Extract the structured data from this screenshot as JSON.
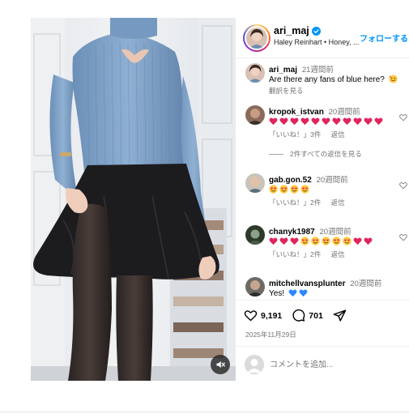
{
  "post": {
    "username": "ari_maj",
    "subtitle": "Haley Reinhart • Honey, ...",
    "follow_label": "フォローする",
    "caption_time": "21週間前",
    "caption_text": "Are there any fans of blue here?",
    "caption_emoji": "smiling-face-with-hearts",
    "translate_label": "翻訳を見る"
  },
  "comments": [
    {
      "user": "kropok_istvan",
      "time": "20週間前",
      "emojis": [
        "red-heart",
        "red-heart",
        "red-heart",
        "red-heart",
        "red-heart",
        "red-heart",
        "red-heart",
        "red-heart",
        "red-heart",
        "red-heart",
        "red-heart"
      ],
      "likes": "「いいね！」3件",
      "reply": "返信",
      "view_replies": "2件すべての返信を見る"
    },
    {
      "user": "gab.gon.52",
      "time": "20週間前",
      "emojis": [
        "heart-eyes",
        "heart-eyes",
        "heart-eyes",
        "heart-eyes"
      ],
      "likes": "「いいね！」2件",
      "reply": "返信"
    },
    {
      "user": "chanyk1987",
      "time": "20週間前",
      "emojis": [
        "red-heart",
        "red-heart",
        "red-heart",
        "heart-eyes",
        "heart-eyes",
        "heart-eyes",
        "heart-eyes",
        "heart-eyes",
        "red-heart",
        "red-heart"
      ],
      "likes": "「いいね！」2件",
      "reply": "返信"
    },
    {
      "user": "mitchellvansplunter",
      "time": "20週間前",
      "text": "Yes!",
      "emojis": [
        "blue-heart",
        "blue-heart"
      ]
    }
  ],
  "actions": {
    "like_count": "9,191",
    "comment_count": "701",
    "date": "2025年11月29日"
  },
  "composer": {
    "placeholder": "コメントを追加..."
  },
  "colors": {
    "accent": "#0095f6",
    "muted": "#737373",
    "heart_red": "#e0245e",
    "blue_heart": "#2d88ff",
    "sweater": "#7fa3c9"
  },
  "icons": {
    "mute": "speaker-muted-icon",
    "like": "heart-outline-icon",
    "comment": "speech-bubble-icon",
    "share": "paper-plane-icon",
    "verified": "verified-badge-icon"
  }
}
